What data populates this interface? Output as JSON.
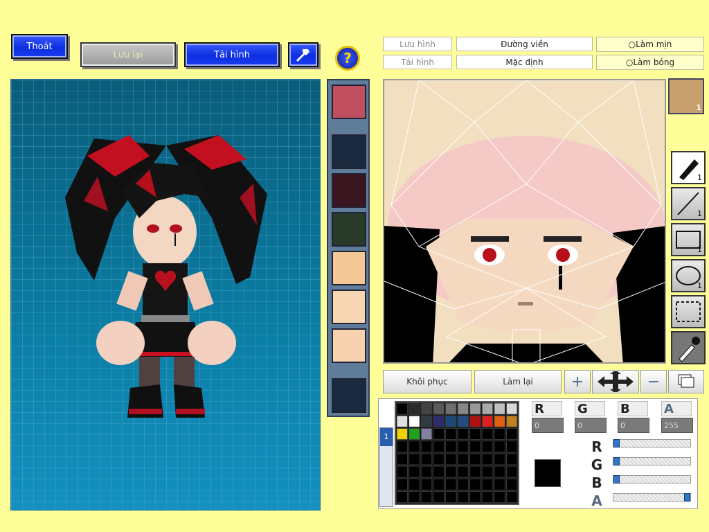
{
  "top": {
    "exit_label": "Thoát",
    "save_label": "Lưu lại",
    "load_label": "Tải hình",
    "help_symbol": "?"
  },
  "editor_toolbar": {
    "row1": [
      "Lưu hình",
      "Đường viền",
      "Làm mịn"
    ],
    "row2": [
      "Tải hình",
      "Mặc định",
      "Làm bóng"
    ]
  },
  "tool_counts": {
    "face": "1",
    "pen": "1",
    "line": "1",
    "rect": "1",
    "ellipse": "1"
  },
  "bottom_buttons": {
    "restore": "Khôi phục",
    "redo": "Làm lại"
  },
  "color_channels": {
    "labels": [
      "R",
      "G",
      "B",
      "A"
    ],
    "values": [
      "0",
      "0",
      "0",
      "255"
    ],
    "slider_fraction": [
      0,
      0,
      0,
      1.0
    ]
  },
  "palette_tab_number": "1",
  "colors": {
    "background": "#ffff99",
    "current_color": "#000000",
    "palette": [
      "#000000",
      "#2a2a2a",
      "#444444",
      "#5a5a5a",
      "#707070",
      "#888888",
      "#9a9a9a",
      "#aaaaaa",
      "#c0c0c0",
      "#d8d8d8",
      "#e0e0e0",
      "#ffffff",
      "#303a40",
      "#2c2c6a",
      "#1a4a78",
      "#244a80",
      "#b01010",
      "#e02020",
      "#e06010",
      "#c08020",
      "#f0d000",
      "#20a020",
      "#8080a0"
    ]
  }
}
